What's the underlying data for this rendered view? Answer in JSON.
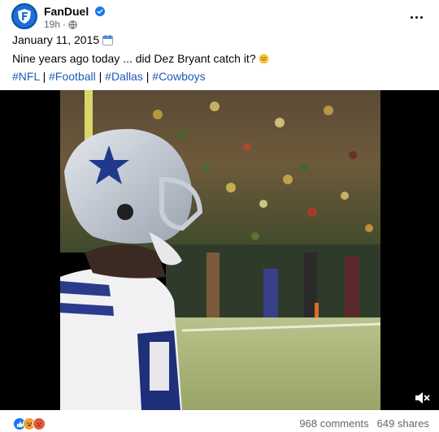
{
  "post": {
    "page_name": "FanDuel",
    "time": "19h",
    "date": "January 11, 2015",
    "caption": "Nine years ago today ... did Dez Bryant catch it?",
    "hashtags": [
      "#NFL",
      "#Football",
      "#Dallas",
      "#Cowboys"
    ],
    "separator": " | "
  },
  "icons": {
    "avatar": "fanduel-logo",
    "verified": "verified-badge-icon",
    "visibility": "globe-icon",
    "more": "more-options-icon",
    "date_emoji": "calendar-icon",
    "caption_emoji": "grinning-face-icon",
    "mute": "muted-speaker-icon"
  },
  "engagement": {
    "reactions": [
      "like",
      "haha",
      "wow"
    ],
    "comments": "968 comments",
    "shares": "649 shares"
  },
  "colors": {
    "brand": "#1b6fd1",
    "hashtag": "#1e5ab8",
    "secondary_text": "#65676b"
  }
}
